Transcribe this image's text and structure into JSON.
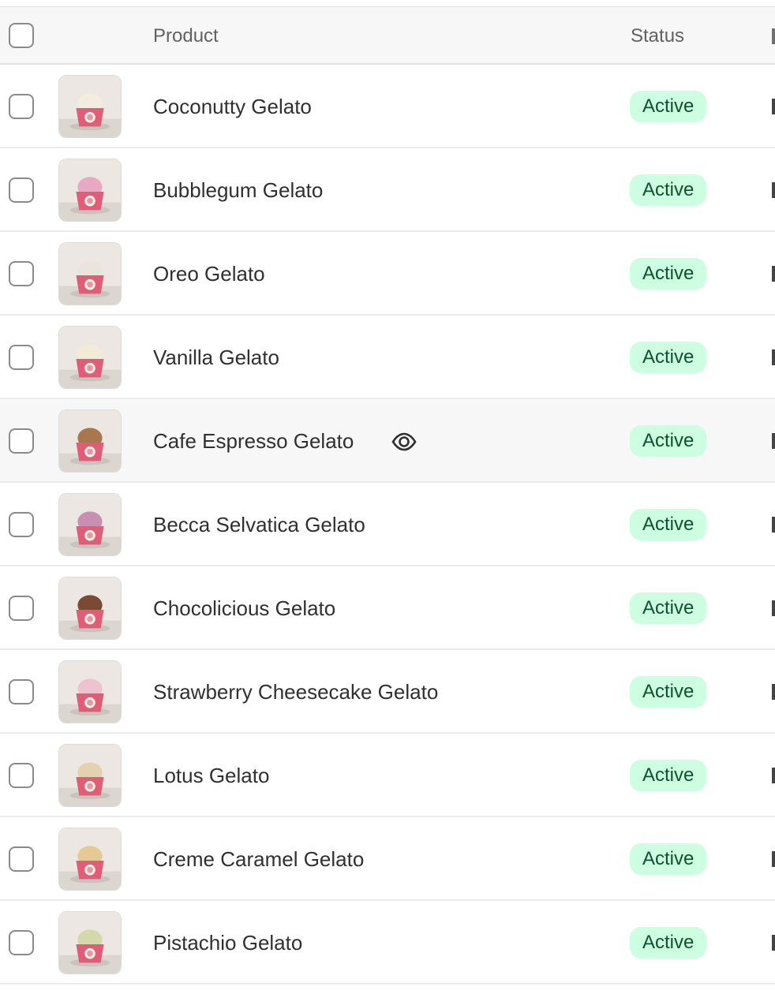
{
  "header": {
    "product_label": "Product",
    "status_label": "Status"
  },
  "rows": [
    {
      "name": "Coconutty Gelato",
      "status": "Active",
      "scoop": "#f3ece0",
      "cup": "#e05d78"
    },
    {
      "name": "Bubblegum Gelato",
      "status": "Active",
      "scoop": "#e7a9c4",
      "cup": "#e05d78"
    },
    {
      "name": "Oreo Gelato",
      "status": "Active",
      "scoop": "#e9e4dc",
      "cup": "#e05d78"
    },
    {
      "name": "Vanilla Gelato",
      "status": "Active",
      "scoop": "#f2ecd6",
      "cup": "#e05d78"
    },
    {
      "name": "Cafe Espresso Gelato",
      "status": "Active",
      "scoop": "#a8764f",
      "cup": "#e05d78"
    },
    {
      "name": "Becca Selvatica Gelato",
      "status": "Active",
      "scoop": "#c98fb3",
      "cup": "#e05d78"
    },
    {
      "name": "Chocolicious Gelato",
      "status": "Active",
      "scoop": "#7a4a33",
      "cup": "#e05d78"
    },
    {
      "name": "Strawberry Cheesecake Gelato",
      "status": "Active",
      "scoop": "#edc3cf",
      "cup": "#e05d78"
    },
    {
      "name": "Lotus Gelato",
      "status": "Active",
      "scoop": "#e3d2b0",
      "cup": "#e05d78"
    },
    {
      "name": "Creme Caramel Gelato",
      "status": "Active",
      "scoop": "#e6c994",
      "cup": "#e05d78"
    },
    {
      "name": "Pistachio Gelato",
      "status": "Active",
      "scoop": "#d3d9a9",
      "cup": "#e05d78"
    }
  ],
  "hovered_row_index": 4,
  "icons": {
    "hover_action": "eye-icon",
    "thumbnail": "gelato-cup-image"
  },
  "colors": {
    "badge_bg": "#cdfee1",
    "badge_text": "#0c5132",
    "header_bg": "#f7f7f7"
  }
}
